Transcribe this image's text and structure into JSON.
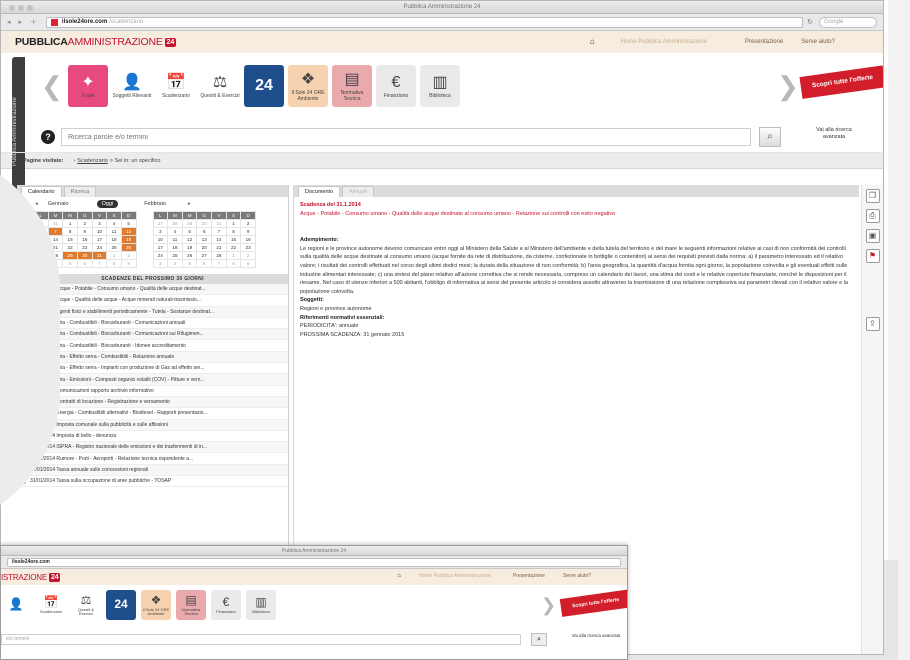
{
  "browser": {
    "window_title": "Pubblica Amministrazione 24",
    "url_host": "ilsole24ore.com",
    "url_path": "/scadenzario",
    "search_placeholder": "Google"
  },
  "header": {
    "logo_bold": "PUBBLICA",
    "logo_light": "AMMINISTRAZIONE",
    "logo_badge": "24",
    "link_faded": "Home Pubblica Amministrazione",
    "link_presentazione": "Presentazione",
    "link_aiuto": "Serve aiuto?"
  },
  "side_tab": {
    "label": "Pubblica Amministrazione"
  },
  "toolbar_icons": [
    {
      "name": "news-icon",
      "label": "Il sole",
      "bg": "#e94a7e",
      "glyph": "✦"
    },
    {
      "name": "people-icon",
      "label": "Soggetti Rilevanti",
      "bg": "#ffffff",
      "glyph": "👤"
    },
    {
      "name": "calendar-icon",
      "label": "Scadenzario",
      "bg": "#ffffff",
      "glyph": "📅"
    },
    {
      "name": "law-icon",
      "label": "Quesiti & Esercizi",
      "bg": "#ffffff",
      "glyph": "⚖"
    },
    {
      "name": "24h-icon",
      "label": "",
      "bg": "#1e4f8c",
      "glyph": "24"
    },
    {
      "name": "tools-icon",
      "label": "Il Sole 24 ORE Ambiente",
      "bg": "#f6d2b0",
      "glyph": "❖"
    },
    {
      "name": "norme-icon",
      "label": "Normativa Tecnica",
      "bg": "#e9a9ad",
      "glyph": "▤"
    },
    {
      "name": "euro-icon",
      "label": "Finanziario",
      "bg": "#eaeaea",
      "glyph": "€"
    },
    {
      "name": "library-icon",
      "label": "Biblioteca",
      "bg": "#eaeaea",
      "glyph": "▥"
    }
  ],
  "ribbon": {
    "label": "Scopri tutte l'offerte"
  },
  "search": {
    "placeholder": "Ricerca parole e/o termini",
    "advanced_label": "Vai alla ricerca avanzata"
  },
  "breadcrumb": {
    "label": "Pagine visitate:",
    "item": "Scadenzario",
    "rest": "> Sei in: un specifico"
  },
  "left_panel": {
    "tabs": [
      "Calendario",
      "Ricerca"
    ],
    "month1": "Gennaio",
    "today": "Oggi",
    "month2": "Febbraio",
    "weekdays": [
      "L",
      "M",
      "M",
      "G",
      "V",
      "S",
      "D"
    ],
    "cal1": [
      [
        "30",
        "31",
        "1",
        "2",
        "3",
        "4",
        "5"
      ],
      [
        "6",
        "7",
        "8",
        "9",
        "10",
        "11",
        "12"
      ],
      [
        "13",
        "14",
        "15",
        "16",
        "17",
        "18",
        "19"
      ],
      [
        "20",
        "21",
        "22",
        "23",
        "24",
        "25",
        "26"
      ],
      [
        "27",
        "28",
        "29",
        "30",
        "31",
        "1",
        "2"
      ],
      [
        "3",
        "4",
        "5",
        "6",
        "7",
        "8",
        "9"
      ]
    ],
    "cal2": [
      [
        "27",
        "28",
        "29",
        "30",
        "31",
        "1",
        "2"
      ],
      [
        "3",
        "4",
        "5",
        "6",
        "7",
        "8",
        "9"
      ],
      [
        "10",
        "11",
        "12",
        "13",
        "14",
        "15",
        "16"
      ],
      [
        "17",
        "18",
        "19",
        "20",
        "21",
        "22",
        "23"
      ],
      [
        "24",
        "25",
        "26",
        "27",
        "28",
        "1",
        "2"
      ],
      [
        "3",
        "4",
        "5",
        "6",
        "7",
        "8",
        "9"
      ]
    ],
    "schedule_title": "SCADENZE DEL PROSSIMO 30 GIORNI",
    "schedule": [
      "30/01/2014  Acque - Potabile - Consumo umano - Qualità delle acque destinat...",
      "31/01/2014  Acque - Qualità delle acque - Acque minerali naturali-trasmissio...",
      "31/01/2014  Agenti fisici e stabilimenti periodicamente - Tutela - Sostanze destinat...",
      "31/01/2014  Aria - Combustibili - Biocarburanti - Comunicazioni annuali",
      "31/01/2014  Aria - Combustibili - Biocarburanti - Comunicazioni sui Rifugimen...",
      "31/01/2014  Aria - Combustibili - Biocarburanti - Idonee accreditamento",
      "31/01/2014  Aria - Effetto serra - Combustibili - Relazione annuale",
      "31/01/2014  Aria - Effetto serra - Impianti con produzione di Gas ad effetto ser...",
      "31/01/2014  Aria - Emissioni - Composti organici volatili (COV) - Pitture e vern...",
      "31/01/2014  Comunicazioni rapporto archivio informativo",
      "31/01/2014  Contratti di locazione - Registrazione e versamento",
      "31/01/2014  Energia - Combustibili alternativi - Biodiesel - Rapporti presentazio...",
      "31/01/2014  Imposta comunale sulla pubblicità e sulle affissioni",
      "31/01/2014  Imposta di bollo - denuncia",
      "31/01/2014  ISPRA - Registro nazionale delle emissioni e dei trasferimenti di in...",
      "31/01/2014  Rumore - Porti - Aeroporti - Relazione tecnica rispondente a...",
      "31/01/2014  Tassa annuale sulle concessioni regionali",
      "31/01/2014  Tassa sulla occupazione di aree pubbliche - TOSAP"
    ]
  },
  "document": {
    "tabs": [
      "Documento",
      "Allegati"
    ],
    "title": "Scadenza del 31.1.2014",
    "subtitle": "Acque - Potabile - Consumo umano - Qualità delle acque destinate al consumo umano - Relazione sui controlli con esito negativo",
    "adempimento_heading": "Adempimento:",
    "adempimento_text": "Le regioni e le province autonome devono comunicare entro oggi al Ministero della Salute e al Ministero dell'ambiente e della tutela del territorio e del mare le seguenti informazioni relative ai casi di non conformità dei controlli sulla qualità delle acque destinate al consumo umano (acque fornite da rete di distribuzione, da cisterne, confezionate in bottiglie o contenitori) ai sensi dei requisiti previsti dalla norma: a) il parametro interessato ed il relativo valore; i risultati dei controlli effettuati nel corso degli ultimi dodici mesi; la durata della situazione di non conformità; b) l'area geografica, la quantità d'acqua fornita ogni giorno, la popolazione coinvolta e gli eventuali effetti sulle industrie alimentari interessate; c) una sintesi del piano relativo all'azione correttiva che si rende necessaria, compreso un calendario dei lavori, una stima dei costi e le relative coperture finanziarie, nonché le disposizioni per il riesame. Nel caso di utenze inferiori a 500 abitanti, l'obbligo di informativa ai sensi del presente articolo si considera assolto attraverso la trasmissione di una relazione complessiva sui parametri rilevati con il relativo valore e la popolazione coinvolta.",
    "soggetti_heading": "Soggetti:",
    "soggetti_text": "Regioni e province autonome",
    "riferimenti_heading": "Riferimenti normativi essenziali:",
    "periodicita": "PERIODICITA': annuale",
    "prossima": "PROSSIMA SCADENZA: 31 gennaio 2015"
  },
  "right_toolbar": {
    "icons": [
      "copy-icon",
      "print-icon",
      "save-icon",
      "pdf-icon",
      "share-icon"
    ]
  },
  "second_window": {
    "window_title": "Pubblica Amministrazione 24",
    "url_host": "ilsole24ore.com",
    "logo_light": "ISTRAZIONE",
    "logo_badge": "24",
    "link_faded": "Home Pubblica Amministrazione",
    "link_presentazione": "Presentazione",
    "link_aiuto": "Serve aiuto?",
    "ribbon": "Scopri tutte l'offerte",
    "search_placeholder": "e/o termini",
    "advanced_label": "Vai alla ricerca avanzata",
    "icons": [
      {
        "name": "people-icon",
        "label": "",
        "bg": "#ffffff",
        "glyph": "👤"
      },
      {
        "name": "calendar-icon",
        "label": "Scadenzario",
        "bg": "#ffffff",
        "glyph": "📅"
      },
      {
        "name": "law-icon",
        "label": "Quesiti & Esercizi",
        "bg": "#ffffff",
        "glyph": "⚖"
      },
      {
        "name": "24h-icon",
        "label": "",
        "bg": "#1e4f8c",
        "glyph": "24"
      },
      {
        "name": "tools-icon",
        "label": "Il Sole 24 ORE Ambiente",
        "bg": "#f6d2b0",
        "glyph": "❖"
      },
      {
        "name": "norme-icon",
        "label": "Normativa Tecnica",
        "bg": "#e9a9ad",
        "glyph": "▤"
      },
      {
        "name": "euro-icon",
        "label": "Finanziario",
        "bg": "#eaeaea",
        "glyph": "€"
      },
      {
        "name": "library-icon",
        "label": "Biblioteca",
        "bg": "#eaeaea",
        "glyph": "▥"
      }
    ]
  },
  "colors": {
    "accent": "#c4122f",
    "header_bg": "#f6ede0",
    "calendar_marker": "#e07b2e"
  }
}
